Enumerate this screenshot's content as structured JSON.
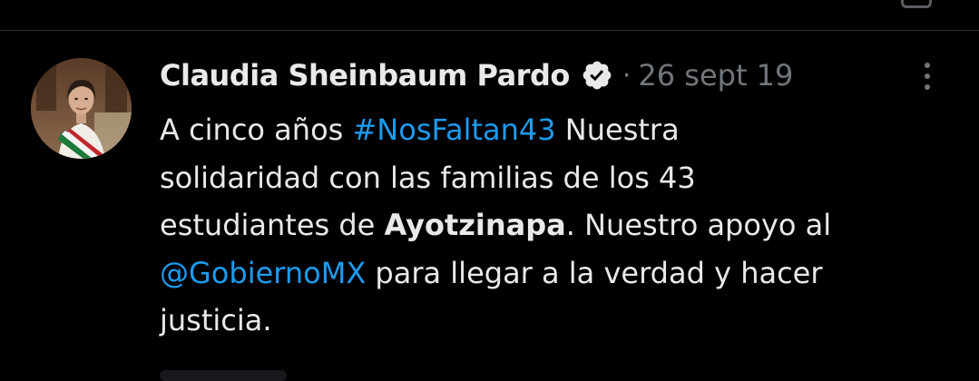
{
  "tweet": {
    "author_name": "Claudia Sheinbaum Pardo",
    "separator": "·",
    "timestamp": "26 sept 19",
    "lines": [
      [
        "A cinco años ",
        "#NosFaltan43",
        " Nuestra"
      ],
      [
        "solidaridad con las familias de los 43"
      ],
      [
        "estudiantes de ",
        "Ayotzinapa",
        ". Nuestro apoyo al"
      ],
      [
        "@GobiernoMX",
        " para llegar a la verdad y hacer"
      ],
      [
        "justicia."
      ]
    ]
  },
  "icons": {
    "verified": "verified-badge-icon",
    "more": "more-options-icon",
    "avatar": "avatar"
  },
  "colors": {
    "background": "#000000",
    "text": "#e7e9ea",
    "muted": "#71767b",
    "link": "#1d9bf0",
    "divider": "#2f3336"
  }
}
